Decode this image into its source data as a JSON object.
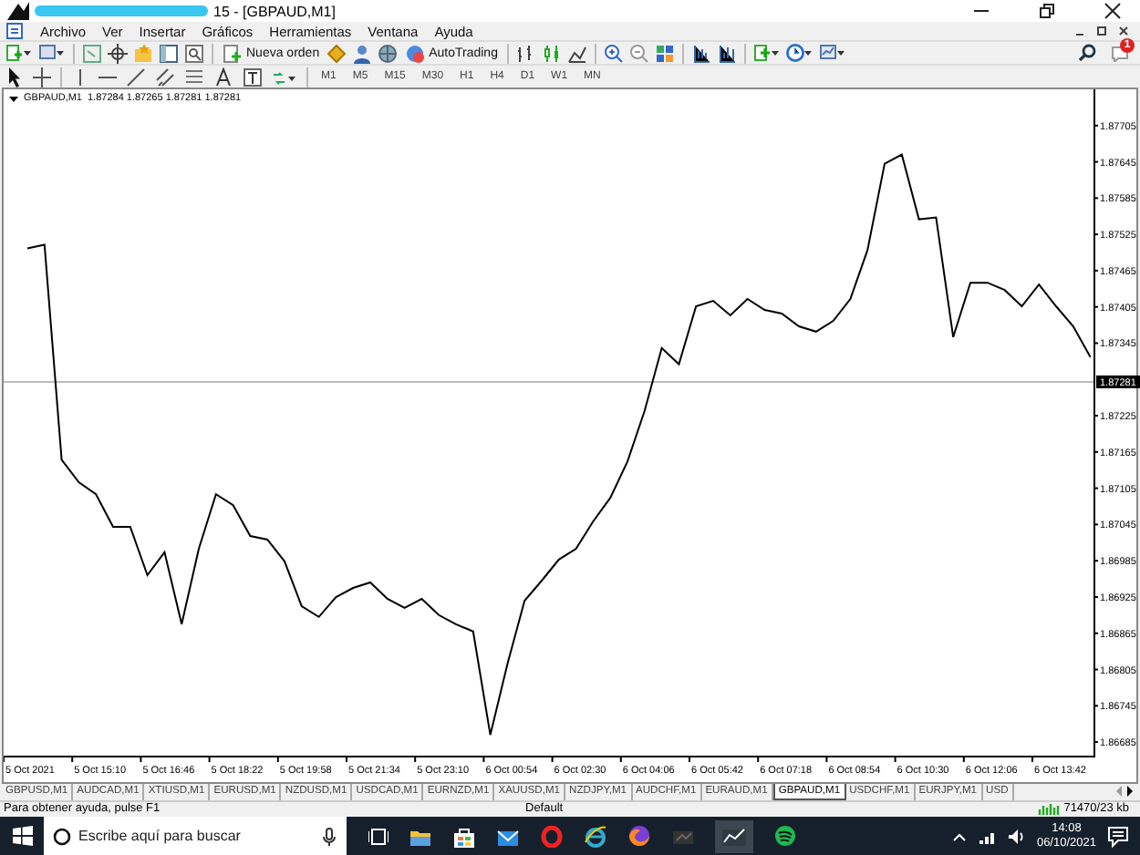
{
  "window": {
    "title": "15 - [GBPAUD,M1]"
  },
  "menu": [
    {
      "label": "Archivo"
    },
    {
      "label": "Ver"
    },
    {
      "label": "Insertar"
    },
    {
      "label": "Gráficos"
    },
    {
      "label": "Herramientas"
    },
    {
      "label": "Ventana"
    },
    {
      "label": "Ayuda"
    }
  ],
  "toolbar": {
    "buttons": [
      {
        "label": "Nueva orden"
      },
      {
        "label": "AutoTrading"
      }
    ],
    "notification_badge": "1"
  },
  "timeframes": [
    {
      "label": "M1"
    },
    {
      "label": "M5"
    },
    {
      "label": "M15"
    },
    {
      "label": "M30"
    },
    {
      "label": "H1"
    },
    {
      "label": "H4"
    },
    {
      "label": "D1"
    },
    {
      "label": "W1"
    },
    {
      "label": "MN"
    }
  ],
  "chart": {
    "symbol": "GBPAUD,M1",
    "quote": "1.87284 1.87265 1.87281 1.87281",
    "chart_data": {
      "type": "line",
      "categories": [
        "5 Oct 2021",
        null,
        null,
        null,
        "5 Oct 15:10",
        null,
        null,
        null,
        "5 Oct 16:46",
        null,
        null,
        null,
        "5 Oct 18:22",
        null,
        null,
        null,
        "5 Oct 19:58",
        null,
        null,
        null,
        "5 Oct 21:34",
        null,
        null,
        null,
        "5 Oct 23:10",
        null,
        null,
        null,
        "6 Oct 00:54",
        null,
        null,
        null,
        "6 Oct 02:30",
        null,
        null,
        null,
        "6 Oct 04:06",
        null,
        null,
        null,
        "6 Oct 05:42",
        null,
        null,
        null,
        "6 Oct 07:18",
        null,
        null,
        null,
        "6 Oct 08:54",
        null,
        null,
        null,
        "6 Oct 10:30",
        null,
        null,
        null,
        "6 Oct 12:06",
        null,
        null,
        null,
        "6 Oct 13:42",
        null,
        null
      ],
      "series": [
        {
          "color": "#000000",
          "values": [
            1.87502,
            1.87508,
            1.87152,
            1.87115,
            1.87095,
            1.87041,
            1.87041,
            1.86961,
            1.86999,
            1.8688,
            1.87005,
            1.87095,
            1.87077,
            1.87026,
            1.8702,
            1.86984,
            1.8691,
            1.86892,
            1.86925,
            1.8694,
            1.86949,
            1.86922,
            1.86907,
            1.86922,
            1.86895,
            1.8688,
            1.86868,
            1.86697,
            1.86814,
            1.86919,
            1.86952,
            1.86987,
            1.87005,
            1.8705,
            1.87089,
            1.87149,
            1.87233,
            1.87337,
            1.8731,
            1.87406,
            1.87415,
            1.87391,
            1.87418,
            1.874,
            1.87394,
            1.87373,
            1.87364,
            1.87382,
            1.87418,
            1.87499,
            1.87642,
            1.87657,
            1.8755,
            1.87553,
            1.87355,
            1.87445,
            1.87445,
            1.87433,
            1.87406,
            1.87442,
            1.87406,
            1.87373,
            1.87322
          ]
        }
      ],
      "ylim": [
        1.86661,
        1.87765
      ],
      "yticks": [
        1.87705,
        1.87645,
        1.87585,
        1.87525,
        1.87465,
        1.87405,
        1.87345,
        1.87225,
        1.87165,
        1.87105,
        1.87045,
        1.86985,
        1.86925,
        1.86865,
        1.86805,
        1.86745,
        1.86685
      ],
      "ref_lines": [
        {
          "axis": "y",
          "value": 1.87281,
          "label": "1.87281",
          "color": "#bbbbbb"
        }
      ]
    }
  },
  "chart_tabs": [
    {
      "label": "GBPUSD,M1",
      "selected": false
    },
    {
      "label": "AUDCAD,M1",
      "selected": false
    },
    {
      "label": "XTIUSD,M1",
      "selected": false
    },
    {
      "label": "EURUSD,M1",
      "selected": false
    },
    {
      "label": "NZDUSD,M1",
      "selected": false
    },
    {
      "label": "USDCAD,M1",
      "selected": false
    },
    {
      "label": "EURNZD,M1",
      "selected": false
    },
    {
      "label": "XAUUSD,M1",
      "selected": false
    },
    {
      "label": "NZDJPY,M1",
      "selected": false
    },
    {
      "label": "AUDCHF,M1",
      "selected": false
    },
    {
      "label": "EURAUD,M1",
      "selected": false
    },
    {
      "label": "GBPAUD,M1",
      "selected": true
    },
    {
      "label": "USDCHF,M1",
      "selected": false
    },
    {
      "label": "EURJPY,M1",
      "selected": false
    },
    {
      "label": "USD",
      "selected": false
    }
  ],
  "status_bar": {
    "help": "Para obtener ayuda, pulse F1",
    "profile": "Default",
    "traffic": "71470/23 kb"
  },
  "taskbar": {
    "search": {
      "placeholder": "Escribe aquí para buscar"
    },
    "time": "14:08",
    "date": "06/10/2021"
  }
}
